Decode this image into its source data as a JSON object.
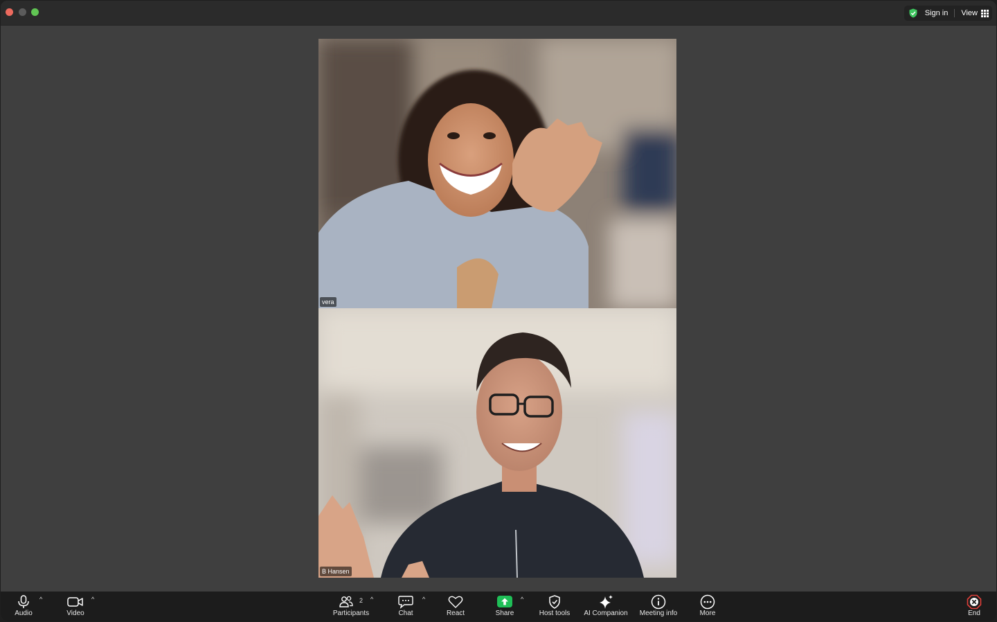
{
  "titlebar": {
    "sign_in": "Sign in",
    "view": "View"
  },
  "participants": [
    {
      "name": "vera"
    },
    {
      "name": "B Hansen"
    }
  ],
  "toolbar": {
    "audio": "Audio",
    "video": "Video",
    "participants": "Participants",
    "participant_count": "2",
    "chat": "Chat",
    "react": "React",
    "share": "Share",
    "host_tools": "Host tools",
    "ai_companion": "AI Companion",
    "meeting_info": "Meeting info",
    "more": "More",
    "end": "End"
  },
  "colors": {
    "window_bg": "#3f3f3f",
    "titlebar_bg": "#2b2b2b",
    "toolbar_bg": "#1c1c1c",
    "share_green": "#1fbf57",
    "end_red": "#e0403a",
    "secure_green": "#3ec55f"
  },
  "icons": {
    "secure": "shield-check-icon",
    "view": "grid-icon",
    "audio": "microphone-icon",
    "video": "camera-icon",
    "participants": "people-icon",
    "chat": "chat-bubble-icon",
    "react": "heart-icon",
    "share": "share-arrow-icon",
    "host_tools": "shield-icon",
    "ai_companion": "sparkle-icon",
    "meeting_info": "info-icon",
    "more": "ellipsis-icon",
    "end": "close-icon"
  }
}
